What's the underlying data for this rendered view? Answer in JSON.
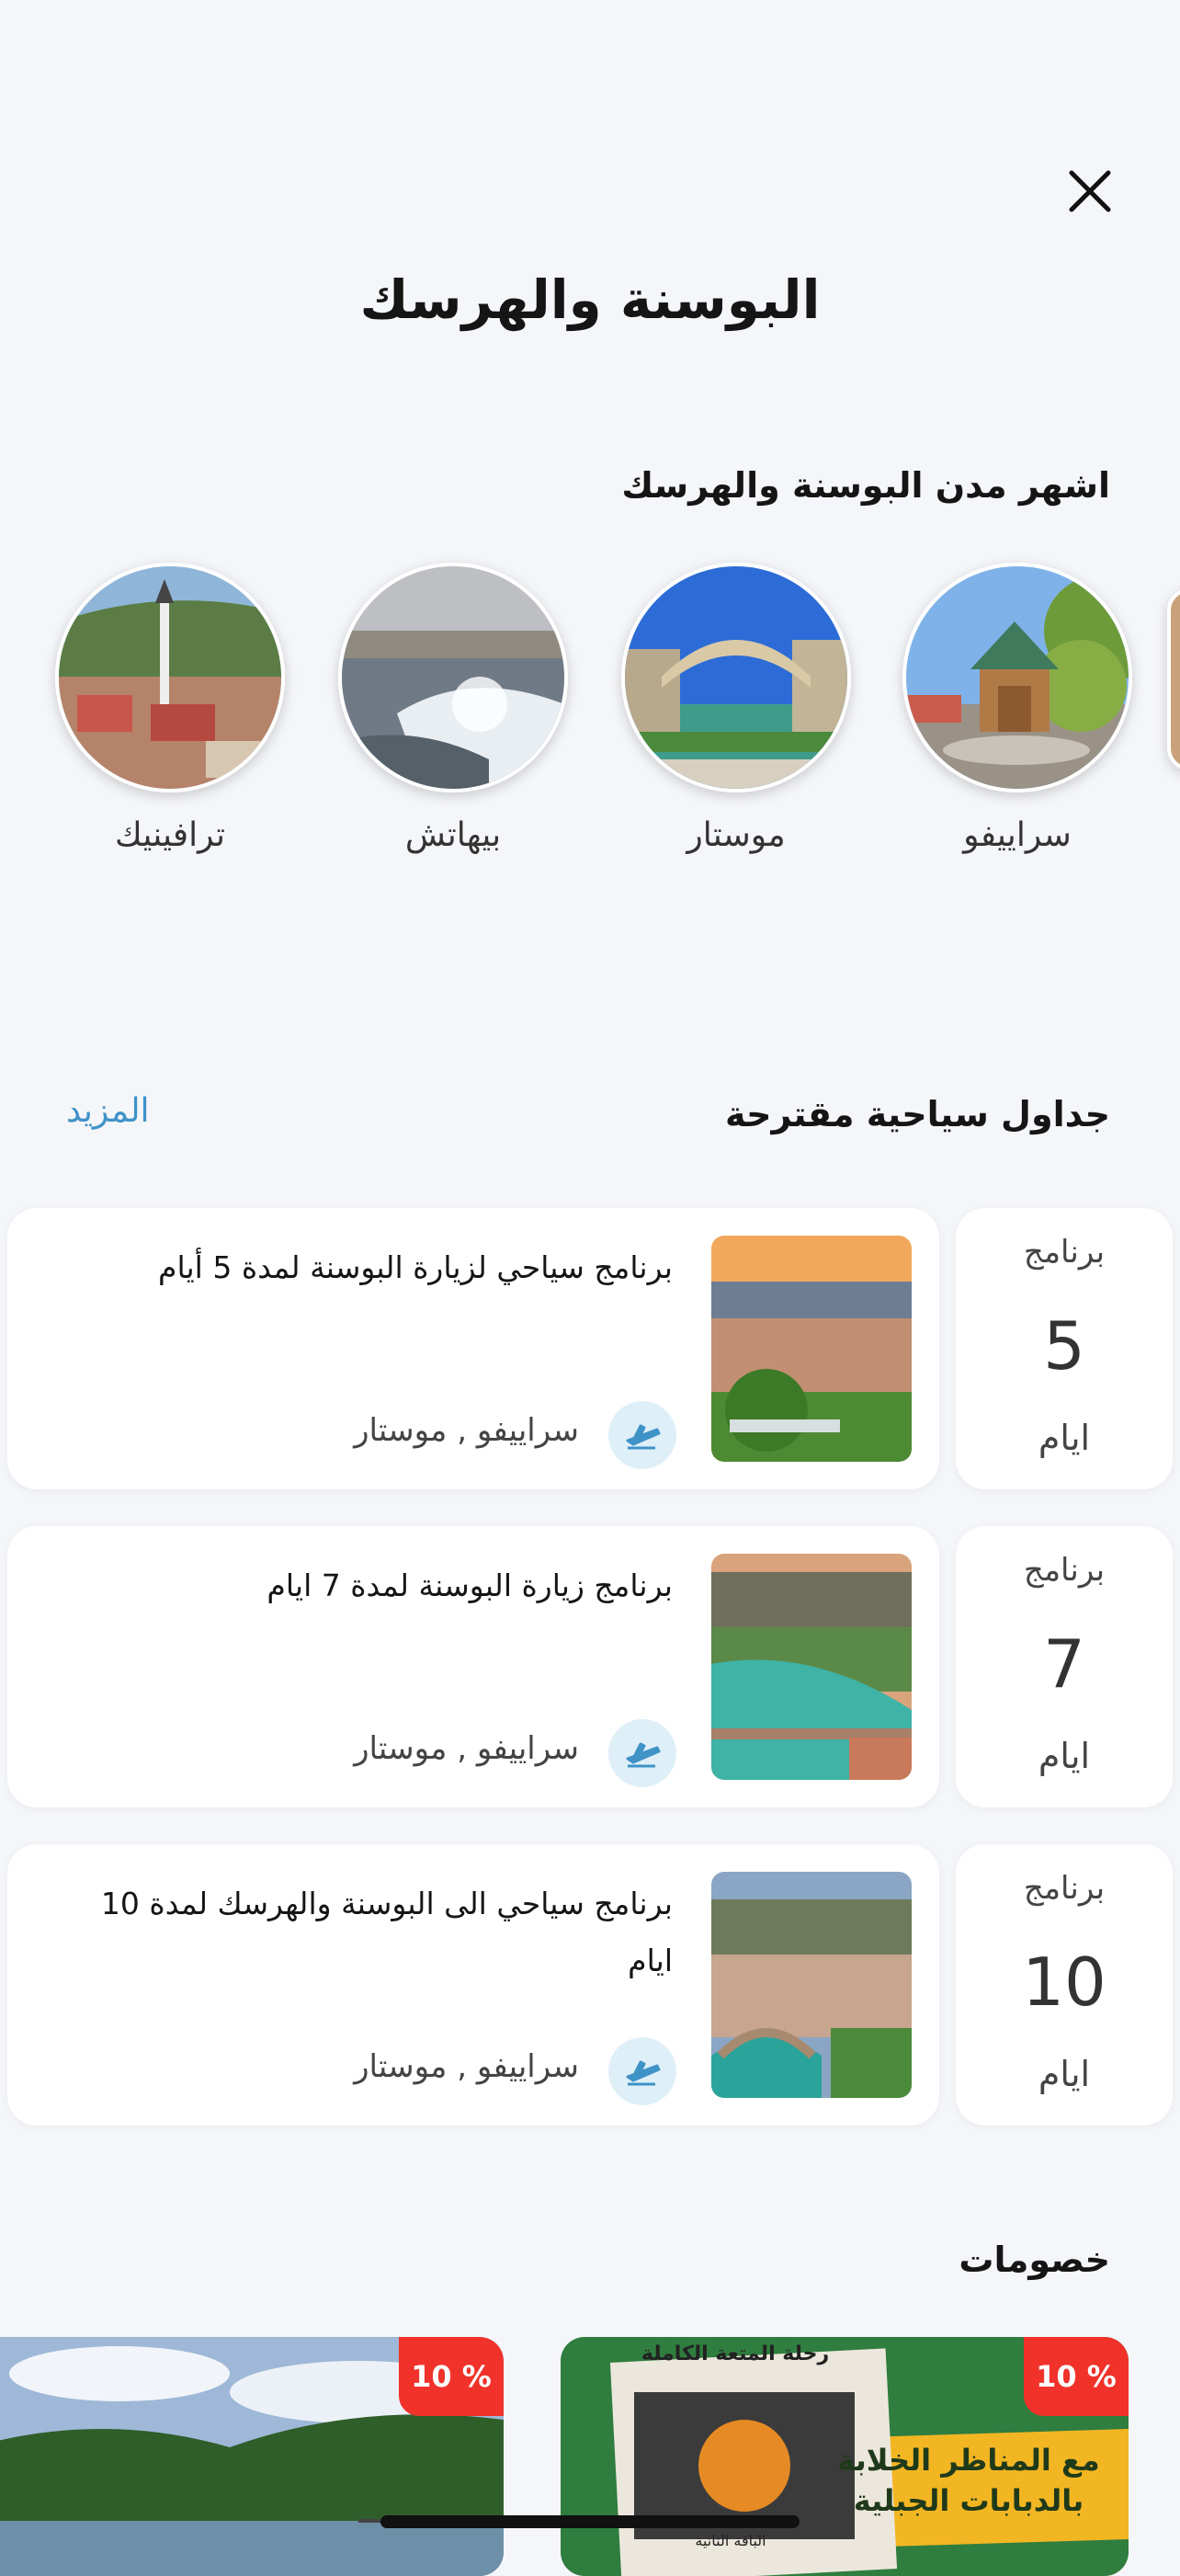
{
  "header": {
    "title": "البوسنة والهرسك"
  },
  "cities_section": {
    "title": "اشهر مدن البوسنة والهرسك",
    "cities": [
      {
        "name": "سراييفو"
      },
      {
        "name": "موستار"
      },
      {
        "name": "بيهاتش"
      },
      {
        "name": "ترافينيك"
      }
    ]
  },
  "schedules_section": {
    "title": "جداول سياحية مقترحة",
    "more_label": "المزيد",
    "programs": [
      {
        "days_top": "برنامج",
        "days_number": "5",
        "days_bottom": "ايام",
        "title": "برنامج سياحي لزيارة البوسنة لمدة 5 أيام",
        "cities": "سراييفو , موستار"
      },
      {
        "days_top": "برنامج",
        "days_number": "7",
        "days_bottom": "ايام",
        "title": "برنامج زيارة البوسنة لمدة 7 ايام",
        "cities": "سراييفو , موستار"
      },
      {
        "days_top": "برنامج",
        "days_number": "10",
        "days_bottom": "ايام",
        "title": "برنامج سياحي الى البوسنة والهرسك لمدة 10 ايام",
        "cities": "سراييفو , موستار"
      }
    ]
  },
  "discounts_section": {
    "title": "خصومات",
    "promos": [
      {
        "badge": "10 %",
        "banner_top": "رحلة المتعة الكاملة",
        "banner_line1": "مع المناظر الخلابة",
        "banner_line2": "بالدبابات الجبلية",
        "banner_small": "الباقة الثانية"
      },
      {
        "badge": "10 %"
      }
    ]
  },
  "icons": {
    "close": "close-icon",
    "plane": "plane-icon"
  },
  "colors": {
    "accent": "#3f93c7",
    "badge": "#f0322a",
    "background": "#f5f6f9"
  }
}
